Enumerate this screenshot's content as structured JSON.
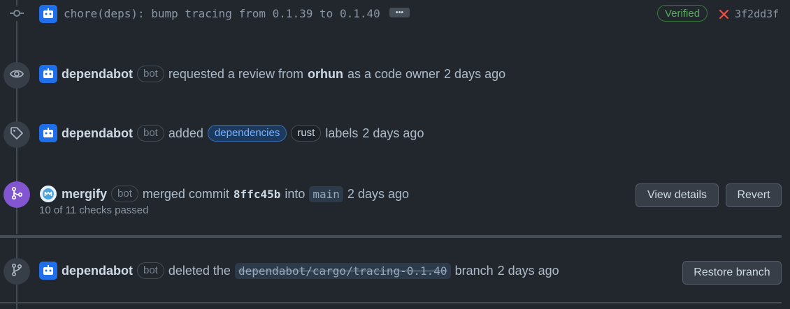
{
  "commit": {
    "message": "chore(deps): bump tracing from 0.1.39 to 0.1.40",
    "ellipsis": "•••",
    "verified": "Verified",
    "status_icon": "x-icon",
    "sha": "3f2dd3f"
  },
  "review_event": {
    "actor": "dependabot",
    "bot_badge": "bot",
    "text": "requested a review from",
    "reviewer": "orhun",
    "suffix": "as a code owner",
    "time": "2 days ago"
  },
  "label_event": {
    "actor": "dependabot",
    "bot_badge": "bot",
    "text": "added",
    "labels": [
      "dependencies",
      "rust"
    ],
    "suffix": "labels",
    "time": "2 days ago"
  },
  "merge_event": {
    "actor": "mergify",
    "bot_badge": "bot",
    "text": "merged commit",
    "commit": "8ffc45b",
    "into": "into",
    "branch": "main",
    "time": "2 days ago",
    "checks": "10 of 11 checks passed",
    "view_details": "View details",
    "revert": "Revert"
  },
  "delete_event": {
    "actor": "dependabot",
    "bot_badge": "bot",
    "text": "deleted the",
    "branch": "dependabot/cargo/tracing-0.1.40",
    "suffix": "branch",
    "time": "2 days ago",
    "restore": "Restore branch"
  },
  "colors": {
    "background": "#22272e",
    "merged": "#8256d0",
    "verified": "#57ab5a",
    "error": "#e5534b",
    "label_blue": "#78b3ff"
  }
}
